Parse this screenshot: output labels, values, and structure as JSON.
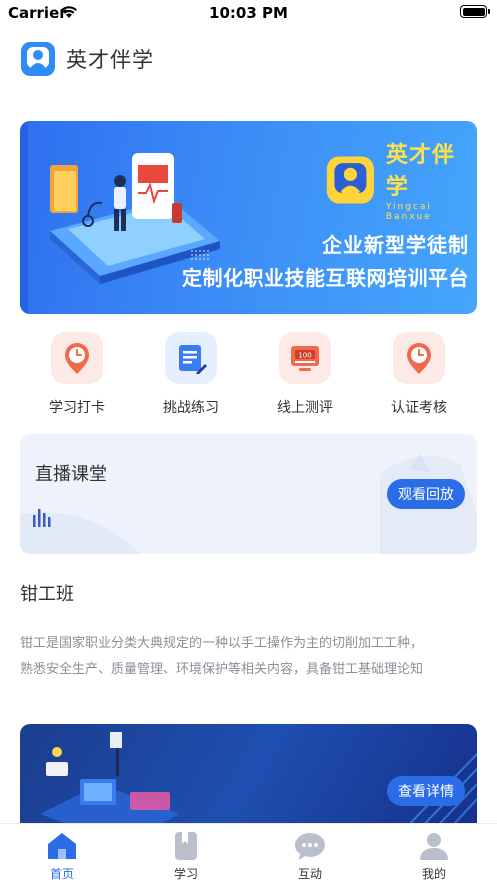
{
  "status_bar": {
    "carrier": "Carrier",
    "time": "10:03 PM"
  },
  "header": {
    "title": "英才伴学"
  },
  "banner": {
    "brand_title": "英才伴学",
    "brand_subtitle": "Yingcai Banxue",
    "line1": "企业新型学徒制",
    "line2": "定制化职业技能互联网培训平台"
  },
  "quick_menu": [
    {
      "label": "学习打卡",
      "icon": "clock-pin-icon"
    },
    {
      "label": "挑战练习",
      "icon": "document-pencil-icon"
    },
    {
      "label": "线上测评",
      "icon": "score-100-icon"
    },
    {
      "label": "认证考核",
      "icon": "clock-pin-icon"
    }
  ],
  "live": {
    "title": "直播课堂",
    "button": "观看回放"
  },
  "course": {
    "title": "钳工班",
    "desc_line1": "钳工是国家职业分类大典规定的一种以手工操作为主的切削加工工种，",
    "desc_line2": "熟悉安全生产、质量管理、环境保护等相关内容，具备钳工基础理论知",
    "button": "查看详情"
  },
  "tabs": [
    {
      "label": "首页",
      "icon": "home-icon",
      "active": true
    },
    {
      "label": "学习",
      "icon": "bookmark-icon",
      "active": false
    },
    {
      "label": "互动",
      "icon": "chat-icon",
      "active": false
    },
    {
      "label": "我的",
      "icon": "user-icon",
      "active": false
    }
  ],
  "colors": {
    "accent": "#2a6de6",
    "banner_brand": "#ffe24a",
    "quick_red_bg": "#fde9e6",
    "quick_blue_bg": "#e5efff",
    "tab_inactive": "#b9bfcc"
  }
}
